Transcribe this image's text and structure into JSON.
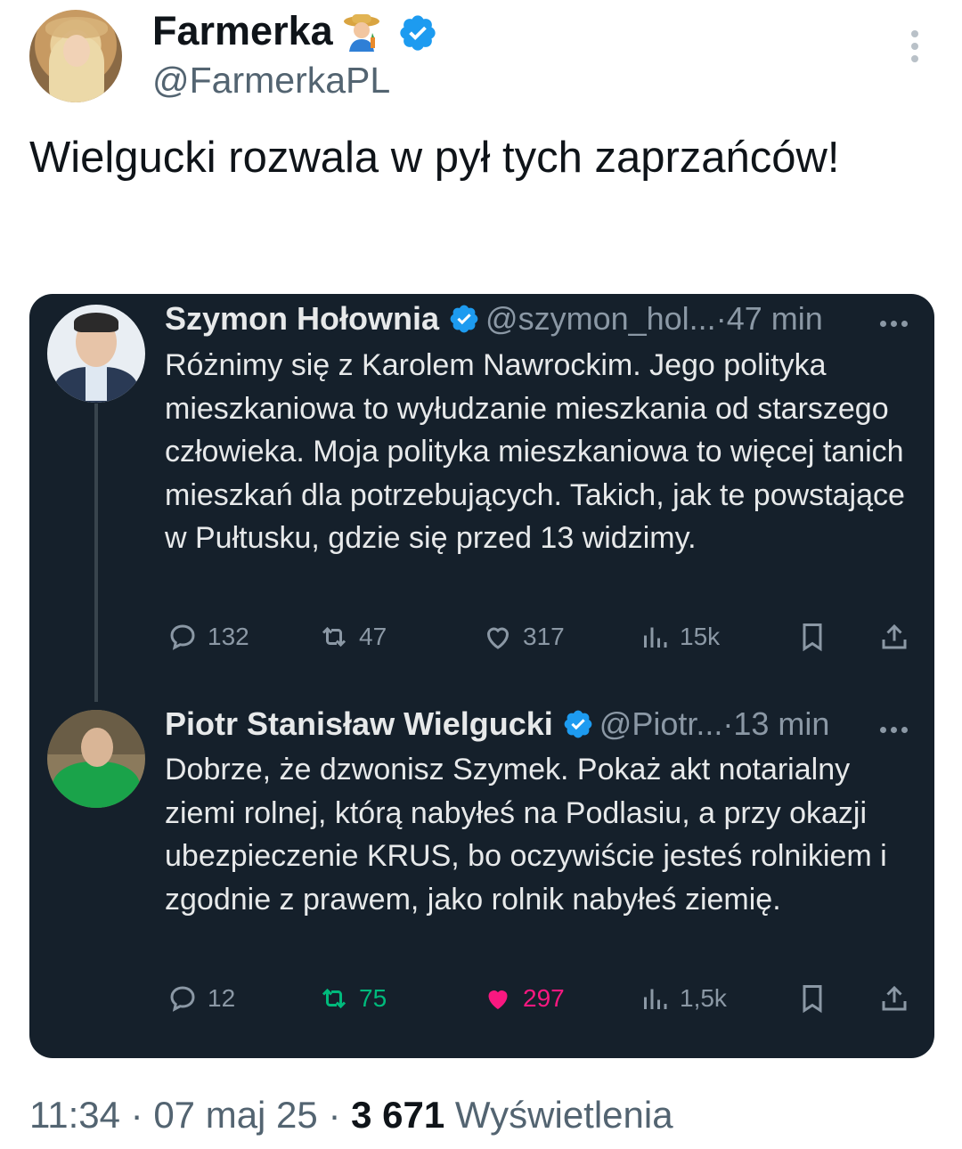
{
  "author": {
    "display_name": "Farmerka",
    "emoji_icon": "farmer-emoji-icon",
    "handle": "@FarmerkaPL",
    "verified": true
  },
  "tweet": {
    "text": "Wielgucki rozwala w pył tych zaprzańców!"
  },
  "quoted_thread": {
    "posts": [
      {
        "name": "Szymon Hołownia",
        "handle": "@szymon_hol...",
        "separator": "·",
        "time": "47 min",
        "text": "Różnimy się z Karolem Nawrockim. Jego polityka mieszkaniowa to wyłudzanie mieszkania od starszego człowieka. Moja polityka mieszkaniowa to więcej tanich mieszkań dla potrzebujących. Takich, jak te powstające w Pułtusku, gdzie się przed 13 widzimy.",
        "replies": "132",
        "reposts": "47",
        "likes": "317",
        "views": "15k"
      },
      {
        "name": "Piotr Stanisław Wielgucki",
        "handle": "@Piotr...",
        "separator": "·",
        "time": "13 min",
        "text": "Dobrze, że dzwonisz Szymek. Pokaż akt notarialny ziemi rolnej, którą nabyłeś na Podlasiu, a przy okazji ubezpieczenie KRUS, bo oczywiście jesteś rolnikiem i zgodnie z prawem, jako rolnik nabyłeś ziemię.",
        "replies": "12",
        "reposts": "75",
        "likes": "297",
        "views": "1,5k"
      }
    ]
  },
  "footer": {
    "time": "11:34",
    "sep1": " · ",
    "date": "07 maj 25",
    "sep2": " · ",
    "views_count": "3 671",
    "views_label": " Wyświetlenia"
  },
  "colors": {
    "verified": "#1d9bf0",
    "dark_bg": "#15202b",
    "repost_active": "#00ba7c",
    "like_active": "#f91880",
    "muted_dark": "#8b98a5",
    "muted_light": "#536471"
  }
}
